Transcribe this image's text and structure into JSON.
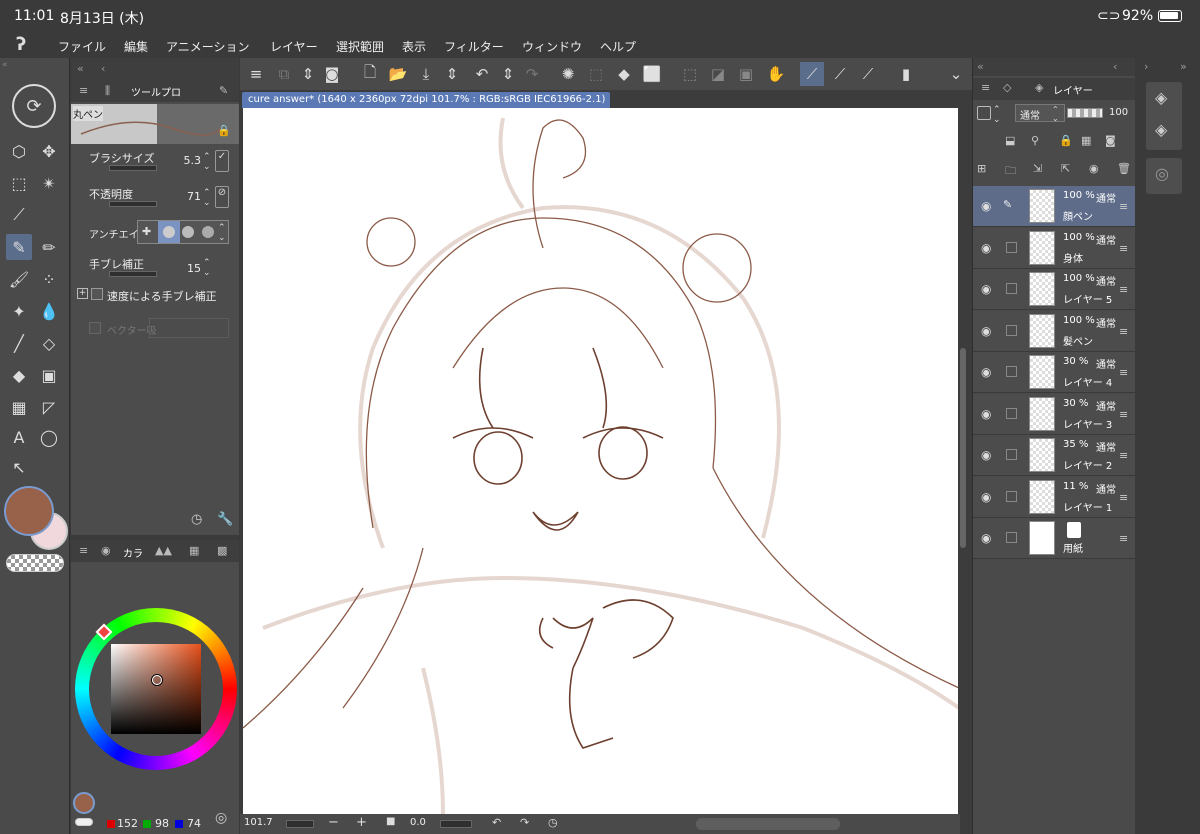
{
  "status_bar": {
    "time": "11:01",
    "date": "8月13日 (木)",
    "battery": "92%"
  },
  "menu": [
    "ファイル",
    "編集",
    "アニメーション",
    "レイヤー",
    "選択範囲",
    "表示",
    "フィルター",
    "ウィンドウ",
    "ヘルプ"
  ],
  "tool_property": {
    "tab_label": "ツールプロ",
    "brush_name": "丸ペン",
    "brush_size_label": "ブラシサイズ",
    "brush_size_value": "5.3",
    "opacity_label": "不透明度",
    "opacity_value": "71",
    "antialias_label": "アンチエイリ",
    "stabilization_label": "手ブレ補正",
    "stabilization_value": "15",
    "speed_stab_label": "速度による手ブレ補正",
    "vector_label": "ベクター吸"
  },
  "color_panel": {
    "tab_label": "カラ",
    "r": "152",
    "g": "98",
    "b": "74",
    "main_color": "#98624a",
    "sub_color": "#f0d8dc"
  },
  "document": {
    "tab_title": "cure answer* (1640 x 2360px 72dpi 101.7% : RGB:sRGB IEC61966-2.1)"
  },
  "canvas_status": {
    "zoom": "101.7",
    "angle": "0.0"
  },
  "layer_panel": {
    "tab_label": "レイヤー",
    "blend_mode": "通常",
    "opacity": "100",
    "layers": [
      {
        "pct": "100 %",
        "mode": "通常",
        "name": "顔ペン"
      },
      {
        "pct": "100 %",
        "mode": "通常",
        "name": "身体"
      },
      {
        "pct": "100 %",
        "mode": "通常",
        "name": "レイヤー 5"
      },
      {
        "pct": "100 %",
        "mode": "通常",
        "name": "髪ペン"
      },
      {
        "pct": "30 %",
        "mode": "通常",
        "name": "レイヤー 4"
      },
      {
        "pct": "30 %",
        "mode": "通常",
        "name": "レイヤー 3"
      },
      {
        "pct": "35 %",
        "mode": "通常",
        "name": "レイヤー 2"
      },
      {
        "pct": "11 %",
        "mode": "通常",
        "name": "レイヤー 1"
      },
      {
        "pct": "",
        "mode": "",
        "name": "用紙"
      }
    ]
  }
}
